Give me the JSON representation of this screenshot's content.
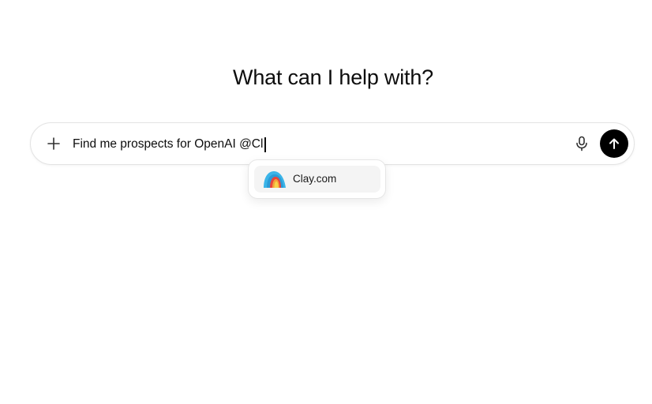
{
  "main": {
    "heading": "What can I help with?"
  },
  "composer": {
    "input_value": "Find me prospects for OpenAI @Cl",
    "plus_icon": "plus-icon",
    "mic_icon": "microphone-icon",
    "send_icon": "arrow-up-icon"
  },
  "mention_popup": {
    "items": [
      {
        "label": "Clay.com",
        "icon": "clay-logo-icon"
      }
    ]
  },
  "colors": {
    "send_button": "#000000",
    "text": "#0d0d0d",
    "popup_item_bg": "#f4f4f4"
  }
}
